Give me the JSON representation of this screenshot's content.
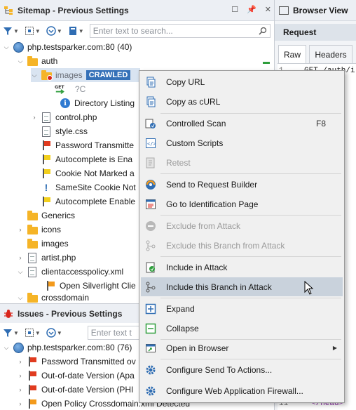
{
  "sitemap_panel": {
    "title": "Sitemap - Previous Settings",
    "search_placeholder": "Enter text to search...",
    "tree": [
      {
        "label": "php.testsparker.com:80 (40)",
        "icon": "globe-icon"
      },
      {
        "label": "auth",
        "icon": "folder-icon"
      },
      {
        "label": "images",
        "badge": "CRAWLED",
        "icon": "folder-blocked-icon"
      },
      {
        "label": "?C",
        "icon": "get-request-icon"
      },
      {
        "label": "Directory Listing",
        "icon": "info-icon"
      },
      {
        "label": "control.php",
        "icon": "file-icon"
      },
      {
        "label": "style.css",
        "icon": "file-icon"
      },
      {
        "label": "Password Transmitte",
        "icon": "red-flag-icon"
      },
      {
        "label": "Autocomplete is Ena",
        "icon": "yellow-flag-icon"
      },
      {
        "label": "Cookie Not Marked a",
        "icon": "yellow-flag-icon"
      },
      {
        "label": "SameSite Cookie Not",
        "icon": "exclamation-icon"
      },
      {
        "label": "Autocomplete Enable",
        "icon": "yellow-flag-icon"
      },
      {
        "label": "Generics",
        "icon": "folder-icon"
      },
      {
        "label": "icons",
        "icon": "folder-icon"
      },
      {
        "label": "images",
        "icon": "folder-icon"
      },
      {
        "label": "artist.php",
        "icon": "file-icon"
      },
      {
        "label": "clientaccesspolicy.xml",
        "icon": "file-icon"
      },
      {
        "label": "Open Silverlight Clie",
        "icon": "orange-flag-icon"
      },
      {
        "label": "crossdomain",
        "icon": "folder-icon"
      }
    ]
  },
  "issues_panel": {
    "title": "Issues - Previous Settings",
    "search_placeholder": "Enter text t",
    "tree": [
      {
        "label": "php.testsparker.com:80 (76)",
        "icon": "globe-icon"
      },
      {
        "label": "Password Transmitted ov",
        "icon": "red-flag-icon"
      },
      {
        "label": "Out-of-date Version (Apa",
        "icon": "red-flag-icon"
      },
      {
        "label": "Out-of-date Version (PHI",
        "icon": "red-flag-icon"
      },
      {
        "label": "Open Policy Crossdomain.xml Detected",
        "icon": "orange-flag-icon"
      }
    ]
  },
  "browser_view": {
    "title": "Browser View",
    "request_label": "Request",
    "tabs": [
      "Raw",
      "Headers"
    ],
    "code_line_number": "1",
    "code_first_line": "GET /auth/i",
    "code_bottom_line_number": "11",
    "code_bottom_text": "</head>"
  },
  "context_menu": {
    "items": [
      {
        "label": "Copy URL",
        "icon": "copy-icon",
        "disabled": false
      },
      {
        "label": "Copy as cURL",
        "icon": "copy-icon",
        "disabled": false
      },
      {
        "label": "Controlled Scan",
        "icon": "controlled-scan-icon",
        "shortcut": "F8",
        "disabled": false
      },
      {
        "label": "Custom Scripts",
        "icon": "script-icon",
        "disabled": false
      },
      {
        "label": "Retest",
        "icon": "retest-icon",
        "disabled": true
      },
      {
        "label": "Send to Request Builder",
        "icon": "request-builder-icon",
        "disabled": false
      },
      {
        "label": "Go to Identification Page",
        "icon": "identification-page-icon",
        "disabled": false
      },
      {
        "label": "Exclude from Attack",
        "icon": "exclude-icon",
        "disabled": true
      },
      {
        "label": "Exclude this Branch from Attack",
        "icon": "exclude-branch-icon",
        "disabled": true
      },
      {
        "label": "Include in Attack",
        "icon": "include-icon",
        "disabled": false
      },
      {
        "label": "Include this Branch in Attack",
        "icon": "include-branch-icon",
        "disabled": false,
        "highlighted": true
      },
      {
        "label": "Expand",
        "icon": "expand-icon",
        "disabled": false
      },
      {
        "label": "Collapse",
        "icon": "collapse-icon",
        "disabled": false
      },
      {
        "label": "Open in Browser",
        "icon": "browser-icon",
        "disabled": false,
        "submenu": true
      },
      {
        "label": "Configure Send To Actions...",
        "icon": "gear-icon",
        "disabled": false
      },
      {
        "label": "Configure Web Application Firewall...",
        "icon": "gear-icon",
        "disabled": false
      }
    ]
  },
  "colors": {
    "accent": "#3571b8",
    "flag_red": "#e03b1f",
    "flag_yellow": "#f2cf1d",
    "flag_orange": "#f39a1c",
    "folder": "#f5b427",
    "menu_highlight": "#c9d2dc"
  }
}
